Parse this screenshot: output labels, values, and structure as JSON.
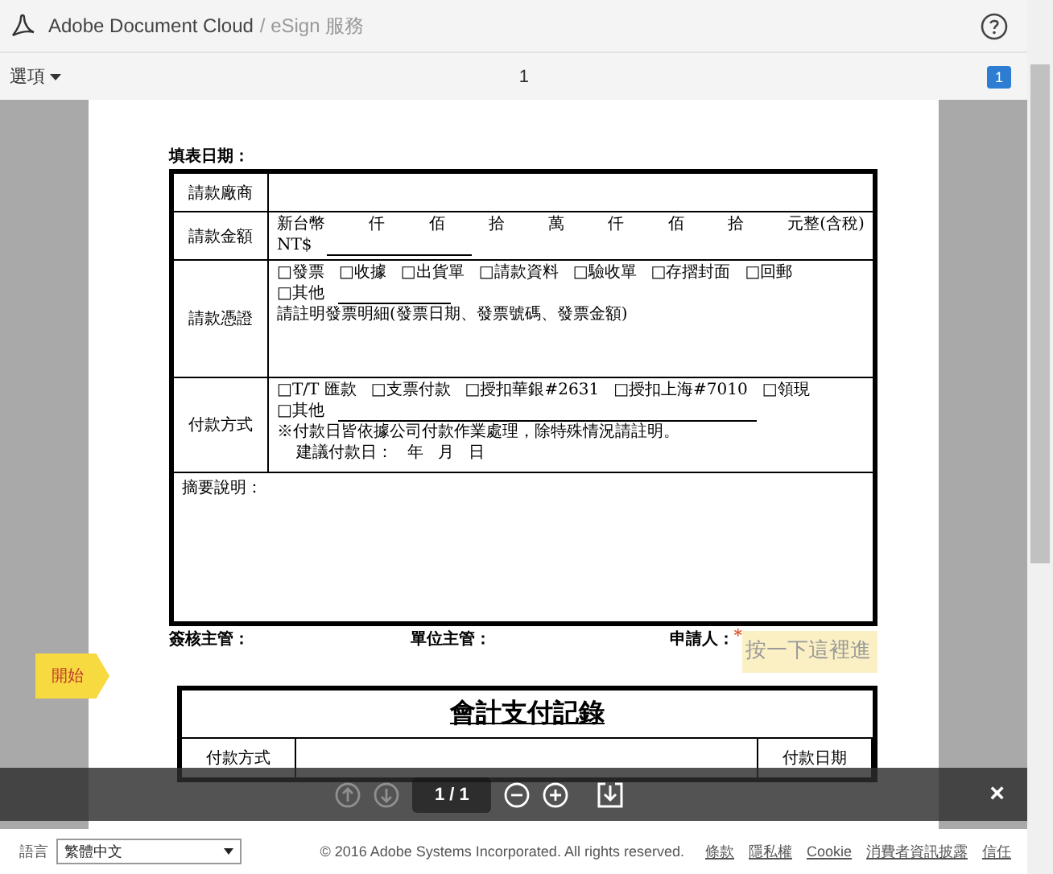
{
  "header": {
    "brand": "Adobe Document Cloud",
    "service": "/ eSign 服務"
  },
  "toolbar": {
    "menu": "選項",
    "page": "1",
    "badge": "1"
  },
  "form": {
    "date_label": "填表日期：",
    "rows": [
      {
        "kind": "blank",
        "label": "請款廠商"
      },
      {
        "kind": "amount",
        "label": "請款金額",
        "words": [
          "新台幣",
          "仟",
          "佰",
          "拾",
          "萬",
          "仟",
          "佰",
          "拾",
          "元整(含稅)"
        ],
        "currency": "NT$"
      },
      {
        "kind": "lines",
        "label": "請款憑證",
        "lines": [
          {
            "items": [
              "□發票",
              "□收據",
              "□出貨單",
              "□請款資料",
              "□驗收單",
              "□存摺封面",
              "□回郵"
            ],
            "blank": false
          },
          {
            "items": [
              "□其他"
            ],
            "blank": true
          },
          {
            "items": [
              "請註明發票明細(發票日期、發票號碼、發票金額)"
            ],
            "blank": false
          }
        ]
      },
      {
        "kind": "lines",
        "label": "付款方式",
        "lines": [
          {
            "items": [
              "□T/T 匯款",
              "□支票付款",
              "□授扣華銀#2631",
              "□授扣上海#7010",
              "□領現"
            ],
            "blank": false
          },
          {
            "items": [
              "□其他"
            ],
            "blank": true
          },
          {
            "items": [
              "※付款日皆依據公司付款作業處理，除特殊情況請註明。"
            ],
            "blank": false
          },
          {
            "items": [
              "建議付款日：",
              "年",
              "月",
              "日"
            ],
            "blank": false
          }
        ]
      },
      {
        "kind": "memo",
        "label": "摘要說明："
      }
    ],
    "signatures": [
      "簽核主管：",
      "單位主管：",
      "申請人："
    ],
    "signer_field": {
      "placeholder": "按一下這裡進",
      "required_mark": "*"
    },
    "start_tag": "開始",
    "record": {
      "title": "會計支付記錄",
      "cells": [
        "付款方式",
        "付款日期"
      ]
    }
  },
  "viewer_bar": {
    "page": "1 / 1",
    "close": "×"
  },
  "footer": {
    "language_label": "語言",
    "language": "繁體中文",
    "copyright": "© 2016 Adobe Systems Incorporated. All rights reserved.",
    "links": [
      "條款",
      "隱私權",
      "Cookie",
      "消費者資訊披露",
      "信任"
    ]
  }
}
